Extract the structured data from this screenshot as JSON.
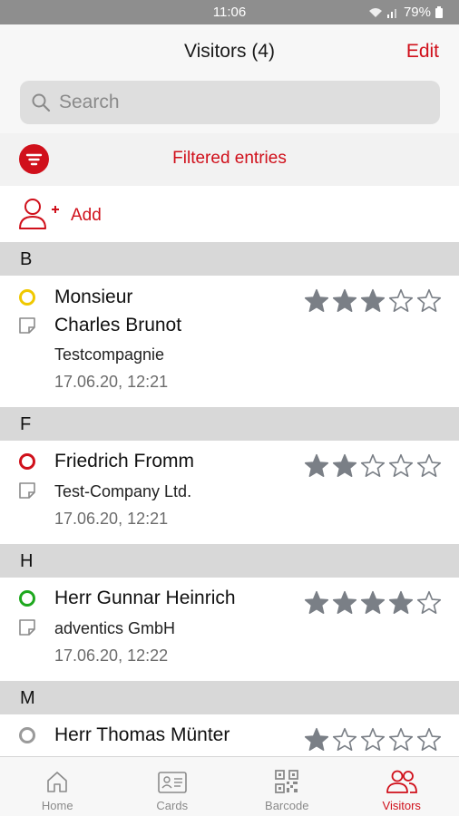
{
  "status_bar": {
    "time": "11:06",
    "battery": "79%"
  },
  "header": {
    "title": "Visitors (4)",
    "edit_label": "Edit"
  },
  "search": {
    "placeholder": "Search"
  },
  "filter": {
    "label": "Filtered entries"
  },
  "add": {
    "label": "Add"
  },
  "sections": [
    {
      "letter": "B",
      "entries": [
        {
          "line1": "Monsieur",
          "line2": "Charles Brunot",
          "company": "Testcompagnie",
          "datetime": "17.06.20, 12:21",
          "status_color": "#f0c800",
          "rating": 3
        }
      ]
    },
    {
      "letter": "F",
      "entries": [
        {
          "name": "Friedrich Fromm",
          "company": "Test-Company Ltd.",
          "datetime": "17.06.20, 12:21",
          "status_color": "#d0101b",
          "rating": 2
        }
      ]
    },
    {
      "letter": "H",
      "entries": [
        {
          "name": "Herr Gunnar Heinrich",
          "company": "adventics GmbH",
          "datetime": "17.06.20, 12:22",
          "status_color": "#1ea81e",
          "rating": 4
        }
      ]
    },
    {
      "letter": "M",
      "entries": [
        {
          "name": "Herr Thomas Münter",
          "status_color": "#9a9a9a",
          "rating": 1
        }
      ]
    }
  ],
  "tabs": [
    {
      "label": "Home",
      "icon": "home-icon",
      "active": false
    },
    {
      "label": "Cards",
      "icon": "card-icon",
      "active": false
    },
    {
      "label": "Barcode",
      "icon": "qr-code-icon",
      "active": false
    },
    {
      "label": "Visitors",
      "icon": "visitors-icon",
      "active": true
    }
  ],
  "colors": {
    "accent": "#d0101b",
    "star": "#7a7f86"
  }
}
